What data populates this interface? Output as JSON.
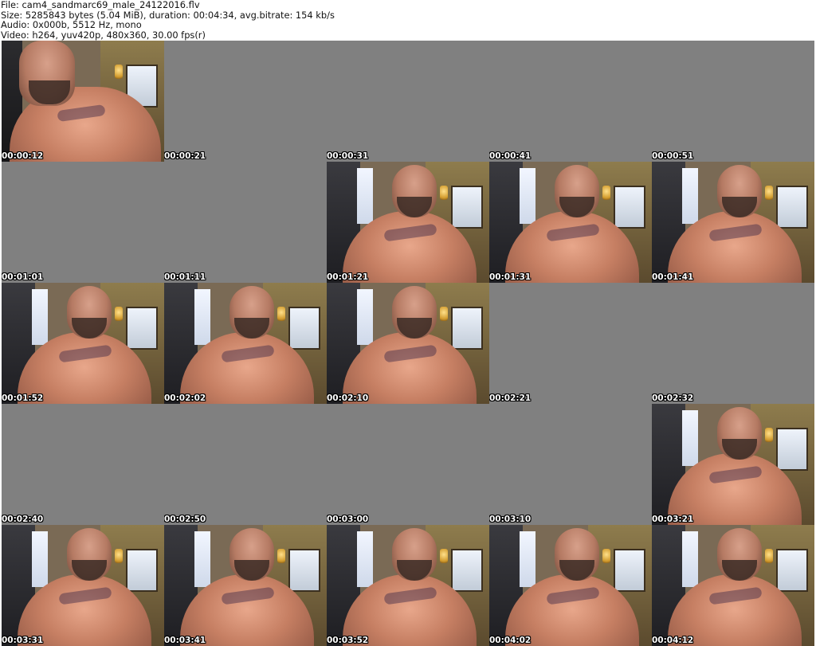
{
  "info": {
    "file": "File: cam4_sandmarc69_male_24122016.flv",
    "size": "Size: 5285843 bytes (5.04 MiB), duration: 00:04:34, avg.bitrate: 154 kb/s",
    "audio": "Audio: 0x000b, 5512 Hz, mono",
    "video": "Video: h264, yuv420p, 480x360, 30.00 fps(r)"
  },
  "colors": {
    "blank_frame": "#808080",
    "background": "#ffffff",
    "timestamp_text": "#ffffff"
  },
  "thumbnails": [
    {
      "time": "00:00:12",
      "blank": false
    },
    {
      "time": "00:00:21",
      "blank": true
    },
    {
      "time": "00:00:31",
      "blank": true
    },
    {
      "time": "00:00:41",
      "blank": true
    },
    {
      "time": "00:00:51",
      "blank": true
    },
    {
      "time": "00:01:01",
      "blank": true
    },
    {
      "time": "00:01:11",
      "blank": true
    },
    {
      "time": "00:01:21",
      "blank": false
    },
    {
      "time": "00:01:31",
      "blank": false
    },
    {
      "time": "00:01:41",
      "blank": false
    },
    {
      "time": "00:01:52",
      "blank": false
    },
    {
      "time": "00:02:02",
      "blank": false
    },
    {
      "time": "00:02:10",
      "blank": false
    },
    {
      "time": "00:02:21",
      "blank": true
    },
    {
      "time": "00:02:32",
      "blank": true
    },
    {
      "time": "00:02:40",
      "blank": true
    },
    {
      "time": "00:02:50",
      "blank": true
    },
    {
      "time": "00:03:00",
      "blank": true
    },
    {
      "time": "00:03:10",
      "blank": true
    },
    {
      "time": "00:03:21",
      "blank": false
    },
    {
      "time": "00:03:31",
      "blank": false
    },
    {
      "time": "00:03:41",
      "blank": false
    },
    {
      "time": "00:03:52",
      "blank": false
    },
    {
      "time": "00:04:02",
      "blank": false
    },
    {
      "time": "00:04:12",
      "blank": false
    }
  ]
}
